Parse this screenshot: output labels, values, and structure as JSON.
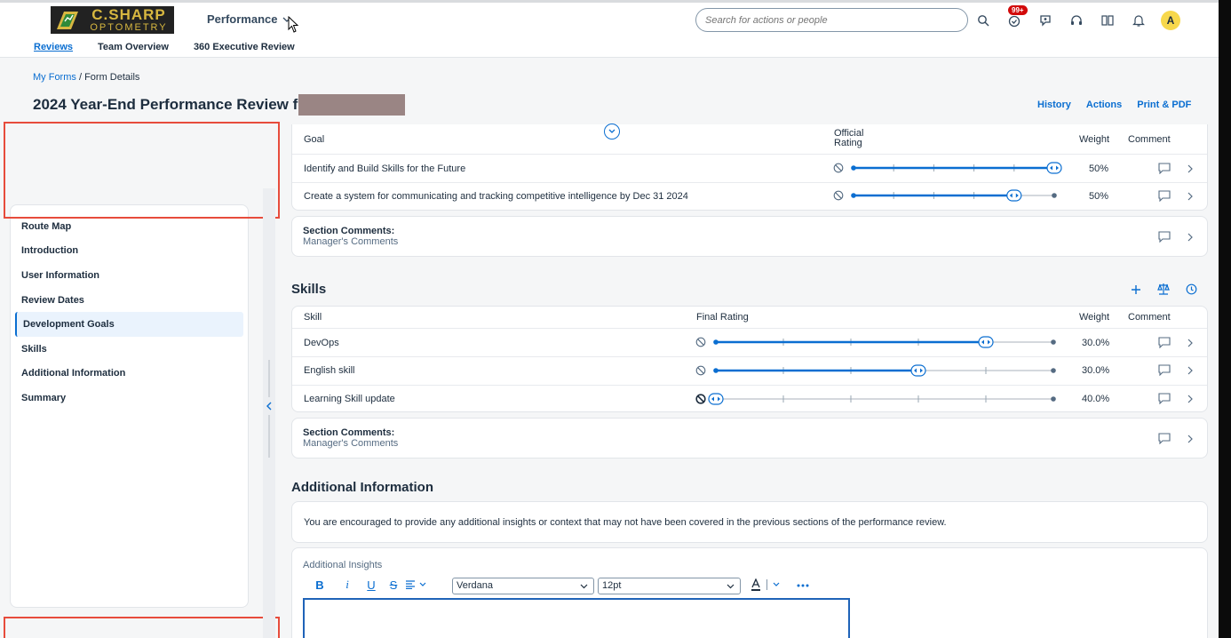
{
  "header": {
    "logo_top": "C.SHARP",
    "logo_bottom": "OPTOMETRY",
    "module": "Performance",
    "search_placeholder": "Search for actions or people",
    "badge": "99+",
    "avatar_initial": "A"
  },
  "subnav": [
    "Reviews",
    "Team Overview",
    "360 Executive Review"
  ],
  "breadcrumb": {
    "link": "My Forms",
    "sep": " / ",
    "current": "Form Details"
  },
  "page_title": "2024 Year-End Performance Review for",
  "page_actions": [
    "History",
    "Actions",
    "Print & PDF"
  ],
  "left_nav": [
    "Route Map",
    "Introduction",
    "User Information",
    "Review Dates",
    "Development Goals",
    "Skills",
    "Additional Information",
    "Summary"
  ],
  "left_nav_selected": "Development Goals",
  "goals": {
    "headers": {
      "name": "Goal",
      "rating_line1": "Official",
      "rating_line2": "Rating",
      "weight": "Weight",
      "comment": "Comment"
    },
    "rows": [
      {
        "name": "Identify and Build Skills for the Future",
        "rating_level": 1.0,
        "weight": "50%"
      },
      {
        "name": "Create a system for communicating and tracking competitive intelligence by Dec 31 2024",
        "rating_level": 0.8,
        "weight": "50%"
      }
    ],
    "section_comments_title": "Section Comments:",
    "section_comments_sub": "Manager's Comments"
  },
  "skills": {
    "title": "Skills",
    "headers": {
      "name": "Skill",
      "rating": "Final Rating",
      "weight": "Weight",
      "comment": "Comment"
    },
    "rows": [
      {
        "name": "DevOps",
        "rating_level": 0.8,
        "weight": "30.0%"
      },
      {
        "name": "English skill",
        "rating_level": 0.6,
        "weight": "30.0%"
      },
      {
        "name": "Learning Skill update",
        "rating_level": 0.0,
        "weight": "40.0%"
      }
    ],
    "section_comments_title": "Section Comments:",
    "section_comments_sub": "Manager's Comments"
  },
  "additional": {
    "title": "Additional Information",
    "intro": "You are encouraged to provide any additional insights or context that may not have been covered in the previous sections of the performance review.",
    "field_label": "Additional Insights",
    "font": "Verdana",
    "size": "12pt"
  },
  "colors": {
    "accent": "#0a6ed1",
    "highlight_box": "#e74c3c",
    "badge": "#d20a0a",
    "avatar": "#f7d84c"
  }
}
